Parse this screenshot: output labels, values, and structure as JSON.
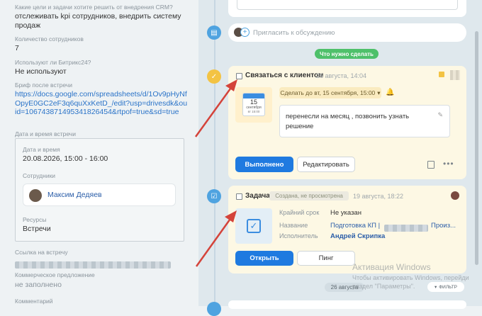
{
  "left": {
    "goals_label": "Какие цели и задачи хотите решить от внедрения CRM?",
    "goals_value": "отслеживать kpi сотрудников, внедрить систему продаж",
    "employees_label": "Количество сотрудников",
    "employees_value": "7",
    "bitrix_label": "Используют ли Битрикс24?",
    "bitrix_value": "Не используют",
    "brief_label": "Бриф после встречи",
    "brief_link": "https://docs.google.com/spreadsheets/d/1Ov9pHyNfOpyE0GC2eF3q6quXxKetD_/edit?usp=drivesdk&ouid=106743871495341826454&rtpof=true&sd=true",
    "meeting_dt_label": "Дата и время встречи",
    "date_time_label": "Дата и время",
    "date_time_value": "20.08.2026, 15:00 - 16:00",
    "staff_label": "Сотрудники",
    "staff_name": "Максим Дедяев",
    "resources_label": "Ресурсы",
    "resources_value": "Встречи",
    "meeting_link_label": "Ссылка на встречу",
    "offer_label": "Коммерческое предложение",
    "offer_value": "не заполнено",
    "comment_label": "Комментарий"
  },
  "feed": {
    "invite_placeholder": "Пригласить к обсуждению",
    "todo_badge": "Что нужно сделать",
    "date_badge": "26 августа",
    "filter_label": "ФИЛЬТР"
  },
  "task1": {
    "title": "Связаться с клиентом",
    "date": "26 августа, 14:04",
    "cal_day": "15",
    "cal_month": "сентября",
    "cal_time": "вт 15:00",
    "deadline": "Сделать до вт, 15 сентября, 15:00",
    "comment": "перенесли на месяц , позвонить узнать решение",
    "done_btn": "Выполнено",
    "edit_btn": "Редактировать"
  },
  "task2": {
    "title": "Задача",
    "status": "Создана, не просмотрена",
    "date": "19 августа, 18:22",
    "deadline_label": "Крайний срок",
    "deadline_value": "Не указан",
    "name_label": "Название",
    "name_value": "Подготовка КП |",
    "name_tail": "Произ...",
    "executor_label": "Исполнитель",
    "executor_value": "Андрей Скрипка",
    "open_btn": "Открыть",
    "ping_btn": "Пинг"
  },
  "windows": {
    "line1": "Активация Windows",
    "line2": "Чтобы активировать Windows, перейди",
    "line3": "раздел \"Параметры\"."
  },
  "colors": {
    "accent": "#1f7ae0",
    "green": "#4ec06a",
    "task_yellow": "#f3c343",
    "task_blue": "#4fa3e0",
    "arrow": "#d4433a"
  }
}
